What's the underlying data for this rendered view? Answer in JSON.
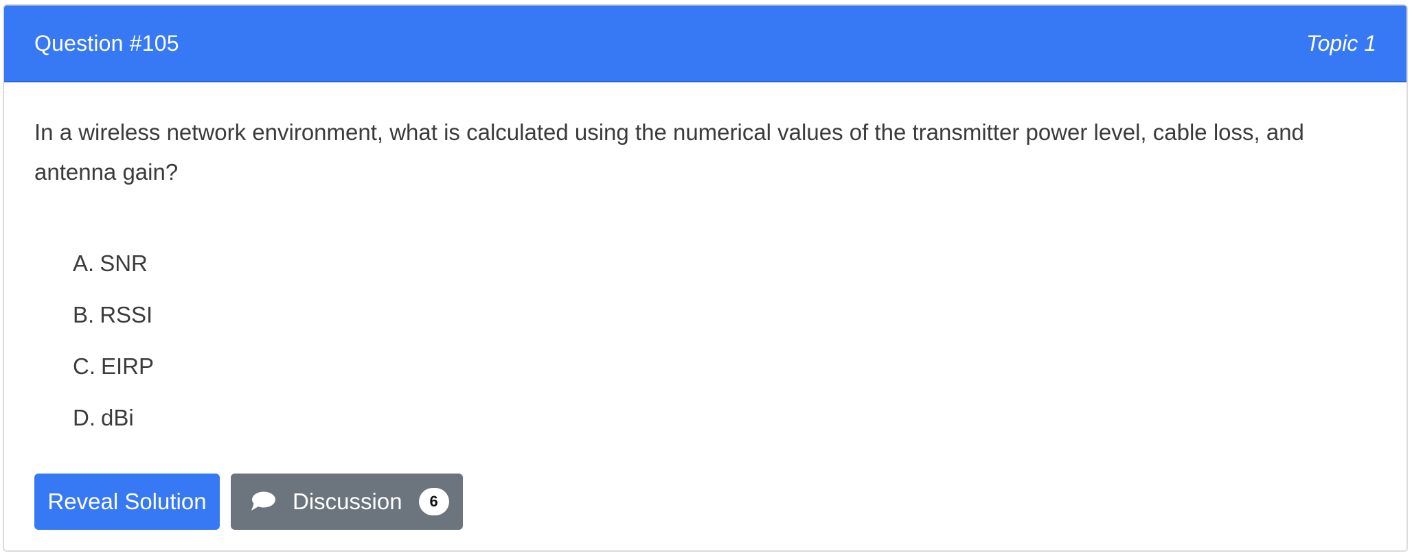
{
  "header": {
    "question_title": "Question #105",
    "topic": "Topic 1"
  },
  "question": {
    "text": "In a wireless network environment, what is calculated using the numerical values of the transmitter power level, cable loss, and antenna gain?"
  },
  "choices": [
    {
      "letter": "A.",
      "text": "SNR"
    },
    {
      "letter": "B.",
      "text": "RSSI"
    },
    {
      "letter": "C.",
      "text": "EIRP"
    },
    {
      "letter": "D.",
      "text": "dBi"
    }
  ],
  "actions": {
    "reveal_label": "Reveal Solution",
    "discussion_label": "Discussion",
    "discussion_count": "6",
    "discussion_icon": "speech-bubble-icon"
  },
  "colors": {
    "header_bg": "#3779f5",
    "primary_button": "#3779f5",
    "secondary_button": "#6c757d"
  }
}
